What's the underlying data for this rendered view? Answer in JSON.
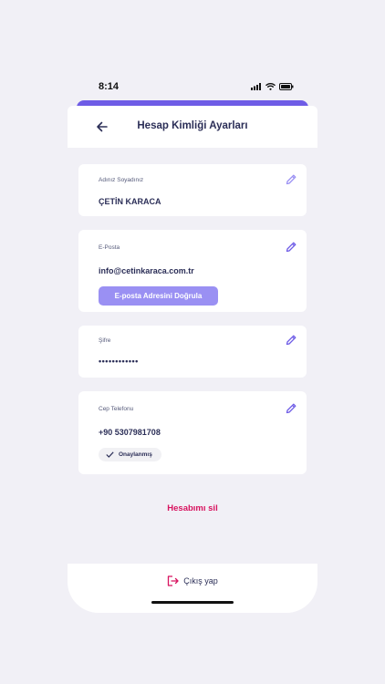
{
  "status_bar": {
    "time": "8:14"
  },
  "header": {
    "title": "Hesap Kimliği Ayarları"
  },
  "name_card": {
    "label": "Adınız Soyadınız",
    "value": "ÇETİN KARACA"
  },
  "email_card": {
    "label": "E-Posta",
    "value": "info@cetinkaraca.com.tr",
    "verify_label": "E-posta Adresini Doğrula"
  },
  "password_card": {
    "label": "Şifre",
    "value": "••••••••••••"
  },
  "phone_card": {
    "label": "Cep Telefonu",
    "value": "+90 5307981708",
    "badge": "Onaylanmış"
  },
  "delete_account": "Hesabımı sil",
  "logout": "Çıkış yap",
  "colors": {
    "accent": "#6e5ce6",
    "accent_light": "#9a90f3",
    "danger": "#d8135f",
    "text": "#2b2e57"
  }
}
